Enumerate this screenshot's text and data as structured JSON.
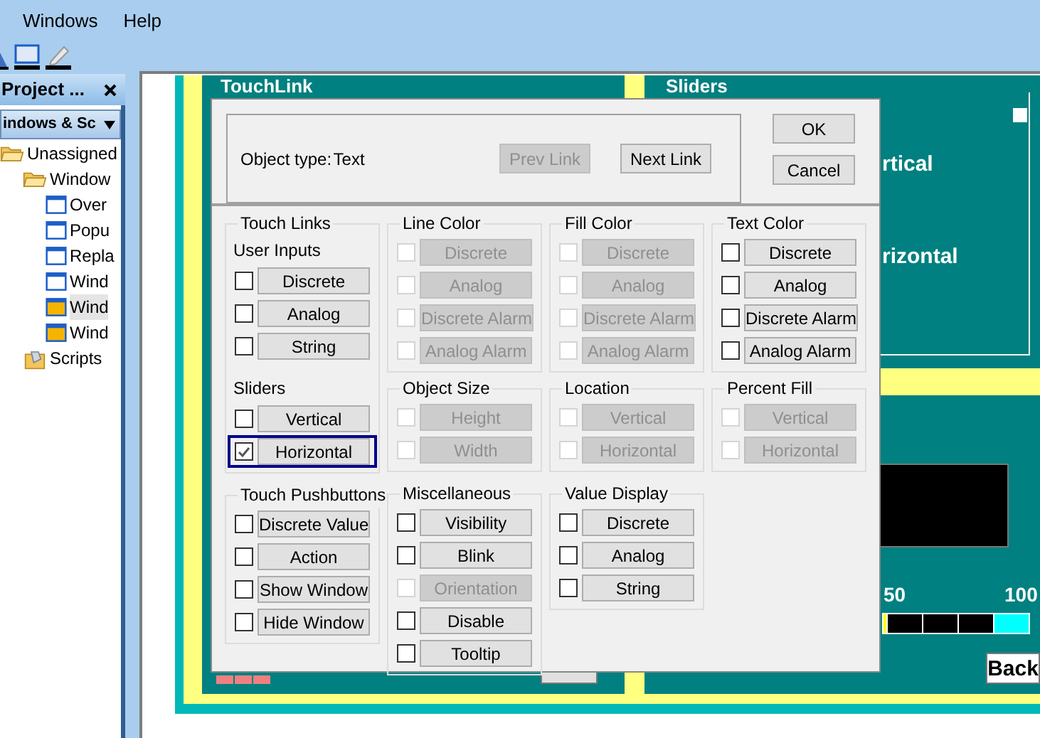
{
  "menu": [
    {
      "label": "Windows"
    },
    {
      "label": "Help"
    }
  ],
  "project_panel": {
    "title": "Project ...",
    "dropdown": {
      "value": "indows & Sc"
    },
    "tree": [
      {
        "label": "Unassigned",
        "kind": "folder",
        "selected": false,
        "expanded": true,
        "children": [
          {
            "label": "Window",
            "kind": "folder",
            "selected": false,
            "expanded": true,
            "children": [
              {
                "label": "Over",
                "kind": "window",
                "selected": false
              },
              {
                "label": "Popu",
                "kind": "window",
                "selected": false
              },
              {
                "label": "Repla",
                "kind": "window",
                "selected": false
              },
              {
                "label": "Wind",
                "kind": "window",
                "selected": false
              },
              {
                "label": "Wind",
                "kind": "window-filled",
                "selected": true
              },
              {
                "label": "Wind",
                "kind": "window-filled",
                "selected": false
              }
            ]
          },
          {
            "label": "Scripts",
            "kind": "scripts",
            "selected": false
          }
        ]
      }
    ]
  },
  "canvas": {
    "touchlink_title": "TouchLink",
    "sliders_title": "Sliders",
    "vertical_label": "rtical",
    "horizontal_label": "rizontal",
    "scale_labels": [
      "50",
      "100"
    ],
    "back_button": "Back"
  },
  "dialog": {
    "object_type_label": "Object type:",
    "object_type_value": "Text",
    "link_buttons": [
      {
        "label": "Prev Link",
        "disabled": true
      },
      {
        "label": "Next Link",
        "disabled": false
      }
    ],
    "buttons": [
      "OK",
      "Cancel"
    ],
    "columns": [
      [
        {
          "title": "Touch Links",
          "sections": [
            {
              "heading": "User Inputs",
              "items": [
                {
                  "label": "Discrete",
                  "checked": false,
                  "disabled": false,
                  "focused": false
                },
                {
                  "label": "Analog",
                  "checked": false,
                  "disabled": false,
                  "focused": false
                },
                {
                  "label": "String",
                  "checked": false,
                  "disabled": false,
                  "focused": false
                }
              ]
            },
            {
              "heading": "Sliders",
              "items": [
                {
                  "label": "Vertical",
                  "checked": false,
                  "disabled": false,
                  "focused": false
                },
                {
                  "label": "Horizontal",
                  "checked": true,
                  "disabled": false,
                  "focused": true
                }
              ]
            }
          ]
        },
        {
          "title": "Touch Pushbuttons",
          "sections": [
            {
              "items": [
                {
                  "label": "Discrete Value",
                  "checked": false,
                  "disabled": false,
                  "focused": false
                },
                {
                  "label": "Action",
                  "checked": false,
                  "disabled": false,
                  "focused": false
                },
                {
                  "label": "Show Window",
                  "checked": false,
                  "disabled": false,
                  "focused": false
                },
                {
                  "label": "Hide Window",
                  "checked": false,
                  "disabled": false,
                  "focused": false
                }
              ]
            }
          ]
        }
      ],
      [
        {
          "title": "Line Color",
          "sections": [
            {
              "items": [
                {
                  "label": "Discrete",
                  "checked": false,
                  "disabled": true,
                  "focused": false
                },
                {
                  "label": "Analog",
                  "checked": false,
                  "disabled": true,
                  "focused": false
                },
                {
                  "label": "Discrete Alarm",
                  "checked": false,
                  "disabled": true,
                  "focused": false
                },
                {
                  "label": "Analog Alarm",
                  "checked": false,
                  "disabled": true,
                  "focused": false
                }
              ]
            }
          ]
        },
        {
          "title": "Object Size",
          "sections": [
            {
              "items": [
                {
                  "label": "Height",
                  "checked": false,
                  "disabled": true,
                  "focused": false
                },
                {
                  "label": "Width",
                  "checked": false,
                  "disabled": true,
                  "focused": false
                }
              ]
            }
          ]
        },
        {
          "title": "Miscellaneous",
          "sections": [
            {
              "items": [
                {
                  "label": "Visibility",
                  "checked": false,
                  "disabled": false,
                  "focused": false
                },
                {
                  "label": "Blink",
                  "checked": false,
                  "disabled": false,
                  "focused": false
                },
                {
                  "label": "Orientation",
                  "checked": false,
                  "disabled": true,
                  "focused": false
                },
                {
                  "label": "Disable",
                  "checked": false,
                  "disabled": false,
                  "focused": false
                },
                {
                  "label": "Tooltip",
                  "checked": false,
                  "disabled": false,
                  "focused": false
                }
              ]
            }
          ]
        }
      ],
      [
        {
          "title": "Fill Color",
          "sections": [
            {
              "items": [
                {
                  "label": "Discrete",
                  "checked": false,
                  "disabled": true,
                  "focused": false
                },
                {
                  "label": "Analog",
                  "checked": false,
                  "disabled": true,
                  "focused": false
                },
                {
                  "label": "Discrete Alarm",
                  "checked": false,
                  "disabled": true,
                  "focused": false
                },
                {
                  "label": "Analog Alarm",
                  "checked": false,
                  "disabled": true,
                  "focused": false
                }
              ]
            }
          ]
        },
        {
          "title": "Location",
          "sections": [
            {
              "items": [
                {
                  "label": "Vertical",
                  "checked": false,
                  "disabled": true,
                  "focused": false
                },
                {
                  "label": "Horizontal",
                  "checked": false,
                  "disabled": true,
                  "focused": false
                }
              ]
            }
          ]
        },
        {
          "title": "Value Display",
          "sections": [
            {
              "items": [
                {
                  "label": "Discrete",
                  "checked": false,
                  "disabled": false,
                  "focused": false
                },
                {
                  "label": "Analog",
                  "checked": false,
                  "disabled": false,
                  "focused": false
                },
                {
                  "label": "String",
                  "checked": false,
                  "disabled": false,
                  "focused": false
                }
              ]
            }
          ]
        }
      ],
      [
        {
          "title": "Text Color",
          "sections": [
            {
              "items": [
                {
                  "label": "Discrete",
                  "checked": false,
                  "disabled": false,
                  "focused": false
                },
                {
                  "label": "Analog",
                  "checked": false,
                  "disabled": false,
                  "focused": false
                },
                {
                  "label": "Discrete Alarm",
                  "checked": false,
                  "disabled": false,
                  "focused": false
                },
                {
                  "label": "Analog Alarm",
                  "checked": false,
                  "disabled": false,
                  "focused": false
                }
              ]
            }
          ]
        },
        {
          "title": "Percent Fill",
          "sections": [
            {
              "items": [
                {
                  "label": "Vertical",
                  "checked": false,
                  "disabled": true,
                  "focused": false
                },
                {
                  "label": "Horizontal",
                  "checked": false,
                  "disabled": true,
                  "focused": false
                }
              ]
            }
          ]
        }
      ]
    ]
  }
}
